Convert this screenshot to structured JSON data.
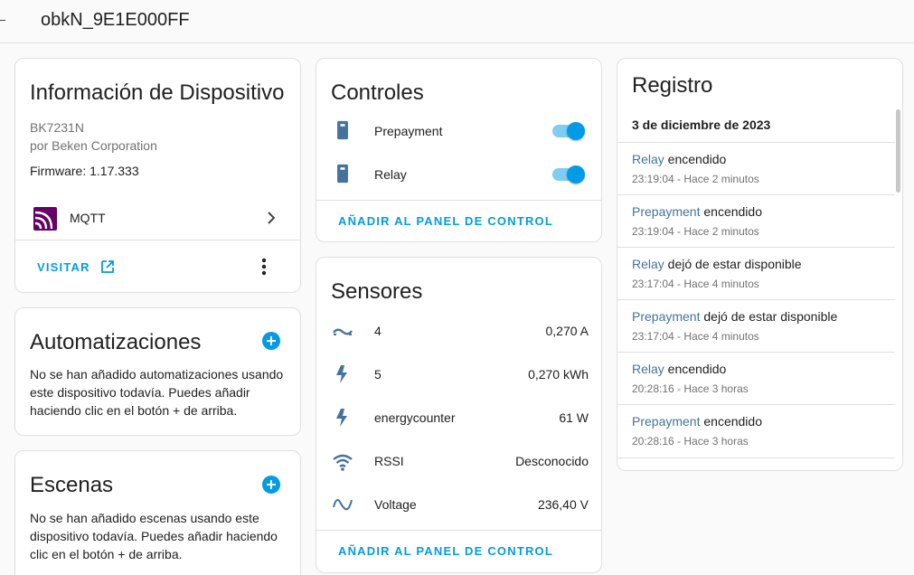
{
  "header": {
    "title": "obkN_9E1E000FF"
  },
  "device_info": {
    "title": "Información de Dispositivo",
    "model": "BK7231N",
    "manufacturer": "por Beken Corporation",
    "firmware": "Firmware: 1.17.333",
    "integration": "MQTT",
    "visit_label": "VISITAR"
  },
  "automations": {
    "title": "Automatizaciones",
    "text": "No se han añadido automatizaciones usando este dispositivo todavía. Puedes añadir haciendo clic en el botón + de arriba."
  },
  "scenes": {
    "title": "Escenas",
    "text": "No se han añadido escenas usando este dispositivo todavía. Puedes añadir haciendo clic en el botón + de arriba."
  },
  "controls": {
    "title": "Controles",
    "items": [
      {
        "label": "Prepayment",
        "on": true
      },
      {
        "label": "Relay",
        "on": true
      }
    ],
    "add_label": "AÑADIR AL PANEL DE CONTROL"
  },
  "sensors": {
    "title": "Sensores",
    "items": [
      {
        "label": "4",
        "value": "0,270 A",
        "icon": "current-ac-icon"
      },
      {
        "label": "5",
        "value": "0,270 kWh",
        "icon": "flash-icon"
      },
      {
        "label": "energycounter",
        "value": "61 W",
        "icon": "flash-icon"
      },
      {
        "label": "RSSI",
        "value": "Desconocido",
        "icon": "wifi-icon"
      },
      {
        "label": "Voltage",
        "value": "236,40 V",
        "icon": "sine-wave-icon"
      }
    ],
    "add_label": "AÑADIR AL PANEL DE CONTROL"
  },
  "log": {
    "title": "Registro",
    "date": "3 de diciembre de 2023",
    "entries": [
      {
        "entity": "Relay",
        "message": " encendido",
        "time": "23:19:04 - Hace 2 minutos"
      },
      {
        "entity": "Prepayment",
        "message": " encendido",
        "time": "23:19:04 - Hace 2 minutos"
      },
      {
        "entity": "Relay",
        "message": " dejó de estar disponible",
        "time": "23:17:04 - Hace 4 minutos"
      },
      {
        "entity": "Prepayment",
        "message": " dejó de estar disponible",
        "time": "23:17:04 - Hace 4 minutos"
      },
      {
        "entity": "Relay",
        "message": " encendido",
        "time": "20:28:16 - Hace 3 horas"
      },
      {
        "entity": "Prepayment",
        "message": " encendido",
        "time": "20:28:16 - Hace 3 horas"
      }
    ]
  },
  "colors": {
    "accent": "#039be5",
    "entity_link": "#44739e",
    "icon": "#44739e",
    "mqtt": "#660066"
  }
}
